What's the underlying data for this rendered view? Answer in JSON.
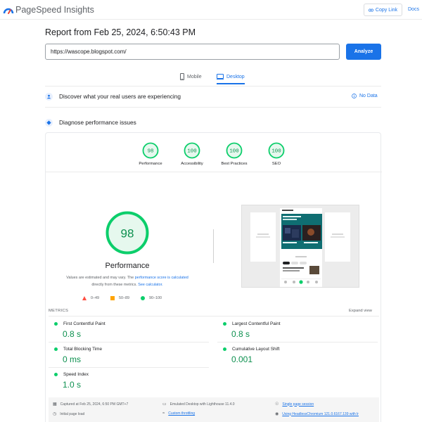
{
  "header": {
    "brand": "PageSpeed Insights",
    "copy_link_label": "Copy Link",
    "docs_label": "Docs"
  },
  "report": {
    "title": "Report from Feb 25, 2024, 6:50:43 PM",
    "url_value": "https://wascope.blogspot.com/",
    "analyze_label": "Analyze"
  },
  "device_tabs": [
    {
      "label": "Mobile",
      "active": false
    },
    {
      "label": "Desktop",
      "active": true
    }
  ],
  "field_data": {
    "heading": "Discover what your real users are experiencing",
    "status": "No Data"
  },
  "diagnose": {
    "heading": "Diagnose performance issues"
  },
  "categories": [
    {
      "score": "98",
      "label": "Performance"
    },
    {
      "score": "100",
      "label": "Accessibility"
    },
    {
      "score": "100",
      "label": "Best Practices"
    },
    {
      "score": "100",
      "label": "SEO"
    }
  ],
  "performance": {
    "score": "98",
    "label": "Performance",
    "note_prefix": "Values are estimated and may vary. The ",
    "note_link1": "performance score is calculated",
    "note_middle": " directly from these metrics. ",
    "note_link2": "See calculator.",
    "legend": [
      {
        "range": "0–49",
        "color": "#ff4e42",
        "shape": "triangle"
      },
      {
        "range": "50–89",
        "color": "#ffa400",
        "shape": "square"
      },
      {
        "range": "90–100",
        "color": "#0cce6b",
        "shape": "circle"
      }
    ]
  },
  "metrics": {
    "section_label": "METRICS",
    "expand_label": "Expand view",
    "items": [
      {
        "name": "First Contentful Paint",
        "value": "0.8 s"
      },
      {
        "name": "Largest Contentful Paint",
        "value": "0.8 s"
      },
      {
        "name": "Total Blocking Time",
        "value": "0 ms"
      },
      {
        "name": "Cumulative Layout Shift",
        "value": "0.001"
      },
      {
        "name": "Speed Index",
        "value": "1.0 s"
      }
    ]
  },
  "runtime": {
    "captured": "Captured at Feb 25, 2024, 6:50 PM GMT+7",
    "emulated": "Emulated Desktop with Lighthouse 11.4.0",
    "session": "Single page session",
    "page_load": "Initial page load",
    "throttling": "Custom throttling",
    "browser": "Using HeadlessChromium 121.0.6167.139 with lr"
  },
  "colors": {
    "accent": "#1a73e8",
    "pass": "#0cce6b",
    "pass_text": "#0d904f",
    "pass_fill": "#e6f8ee"
  },
  "icons": [
    "pagespeed-logo-icon",
    "link-icon",
    "mobile-icon",
    "desktop-icon",
    "people-icon",
    "info-icon",
    "diagnose-icon",
    "calendar-icon",
    "desktop-emulation-icon",
    "session-icon",
    "timer-icon",
    "wifi-icon",
    "browser-icon"
  ]
}
